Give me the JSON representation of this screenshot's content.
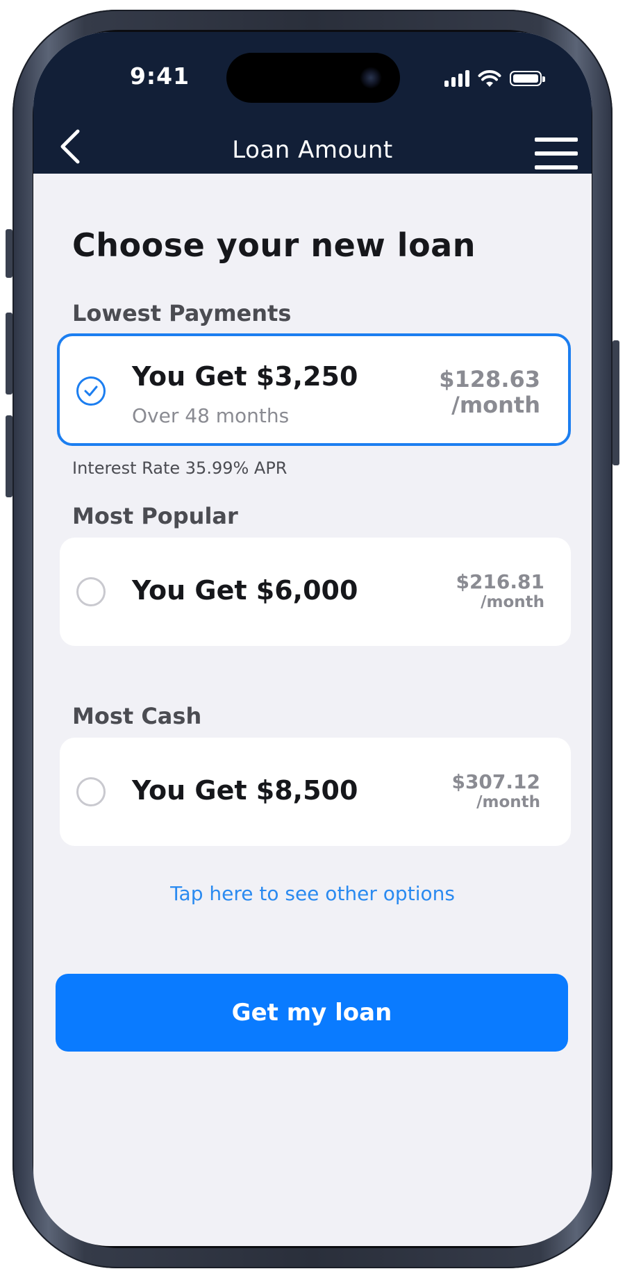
{
  "status_bar": {
    "time": "9:41"
  },
  "nav": {
    "title": "Loan Amount"
  },
  "heading": "Choose your new loan",
  "options": [
    {
      "section": "Lowest Payments",
      "amount": "You Get $3,250",
      "term": "Over 48 months",
      "payment": "$128.63",
      "per": "/month",
      "selected": true,
      "note": "Interest Rate 35.99% APR"
    },
    {
      "section": "Most Popular",
      "amount": "You Get $6,000",
      "payment": "$216.81",
      "per": "/month",
      "selected": false
    },
    {
      "section": "Most Cash",
      "amount": "You Get $8,500",
      "payment": "$307.12",
      "per": "/month",
      "selected": false
    }
  ],
  "other_options_link": "Tap here to see other options",
  "cta_label": "Get my loan",
  "colors": {
    "nav_bg": "#121f37",
    "accent": "#0a7bff",
    "screen_bg": "#f1f1f6"
  },
  "icons": [
    "back-chevron-icon",
    "hamburger-menu-icon",
    "signal-icon",
    "wifi-icon",
    "battery-icon",
    "checkmark-icon"
  ]
}
